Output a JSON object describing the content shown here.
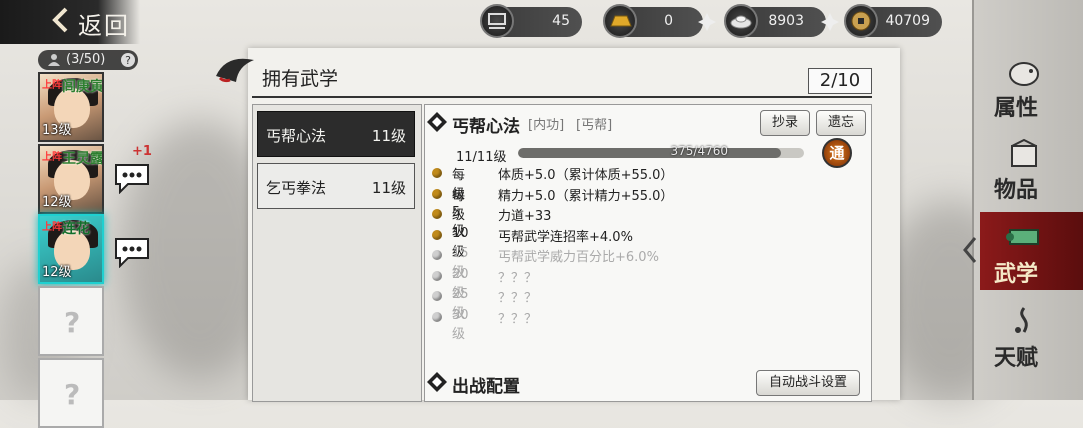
{
  "header": {
    "back_label": "返回",
    "resources": [
      {
        "icon": "cart-icon",
        "value": "45"
      },
      {
        "icon": "gold-bar-icon",
        "value": "0"
      },
      {
        "icon": "silver-ingot-icon",
        "value": "8903"
      },
      {
        "icon": "copper-coin-icon",
        "value": "40709"
      }
    ]
  },
  "roster": {
    "count": "(3/50)",
    "characters": [
      {
        "tag": "上阵",
        "name": "闾庚寅",
        "level": "13级",
        "boost": ""
      },
      {
        "tag": "上阵",
        "name": "王灵露",
        "level": "12级",
        "boost": "+1"
      },
      {
        "tag": "上阵",
        "name": "连花",
        "level": "12级",
        "boost": ""
      }
    ],
    "empty_slot": "?"
  },
  "panel": {
    "title": "拥有武学",
    "count": "2/10",
    "skills": [
      {
        "name": "丐帮心法",
        "level": "11级"
      },
      {
        "name": "乞丐拳法",
        "level": "11级"
      }
    ]
  },
  "detail": {
    "name": "丐帮心法",
    "tags": [
      "[内功]",
      "[丐帮]"
    ],
    "copy_button": "抄录",
    "forget_button": "遗忘",
    "progress_label": "11/11级",
    "progress_text": "375/4760",
    "progress_fraction": 0.92,
    "mastery_badge": "通",
    "effects": [
      {
        "level": "每级",
        "effect": "体质+5.0（累计体质+55.0）",
        "unlocked": true
      },
      {
        "level": "每级",
        "effect": "精力+5.0（累计精力+55.0）",
        "unlocked": true
      },
      {
        "level": "5级",
        "effect": "力道+33",
        "unlocked": true
      },
      {
        "level": "10级",
        "effect": "丐帮武学连招率+4.0%",
        "unlocked": true
      },
      {
        "level": "15级",
        "effect": "丐帮武学威力百分比+6.0%",
        "unlocked": false
      },
      {
        "level": "20级",
        "effect": "？？？",
        "unlocked": false
      },
      {
        "level": "25级",
        "effect": "？？？",
        "unlocked": false
      },
      {
        "level": "30级",
        "effect": "？？？",
        "unlocked": false
      }
    ],
    "battle_title": "出战配置",
    "auto_battle_button": "自动战斗设置"
  },
  "nav": {
    "tabs": [
      {
        "label": "属性",
        "icon": "pig-icon"
      },
      {
        "label": "物品",
        "icon": "box-icon"
      },
      {
        "label": "武学",
        "icon": "scroll-icon",
        "active": true
      },
      {
        "label": "天赋",
        "icon": "talent-icon"
      }
    ]
  }
}
